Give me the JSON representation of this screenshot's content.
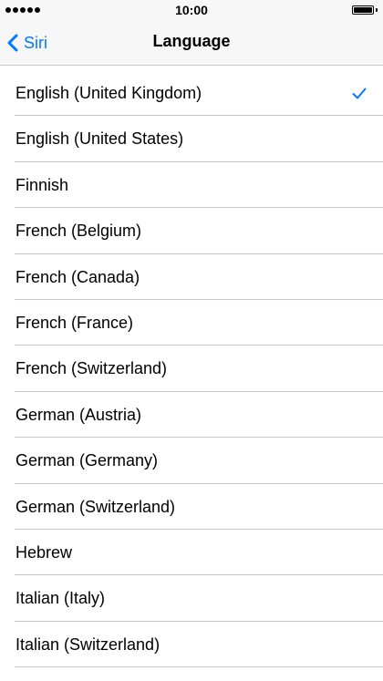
{
  "status_bar": {
    "time": "10:00",
    "signal_icon": "signal-dots-icon",
    "battery_icon": "battery-full-icon",
    "battery_level": 1.0
  },
  "nav": {
    "back_label": "Siri",
    "back_icon": "chevron-left-icon",
    "title": "Language"
  },
  "accent_color": "#007aff",
  "languages": [
    {
      "label": "English (United Kingdom)",
      "selected": true
    },
    {
      "label": "English (United States)",
      "selected": false
    },
    {
      "label": "Finnish",
      "selected": false
    },
    {
      "label": "French (Belgium)",
      "selected": false
    },
    {
      "label": "French (Canada)",
      "selected": false
    },
    {
      "label": "French (France)",
      "selected": false
    },
    {
      "label": "French (Switzerland)",
      "selected": false
    },
    {
      "label": "German (Austria)",
      "selected": false
    },
    {
      "label": "German (Germany)",
      "selected": false
    },
    {
      "label": "German (Switzerland)",
      "selected": false
    },
    {
      "label": "Hebrew",
      "selected": false
    },
    {
      "label": "Italian (Italy)",
      "selected": false
    },
    {
      "label": "Italian (Switzerland)",
      "selected": false
    }
  ]
}
